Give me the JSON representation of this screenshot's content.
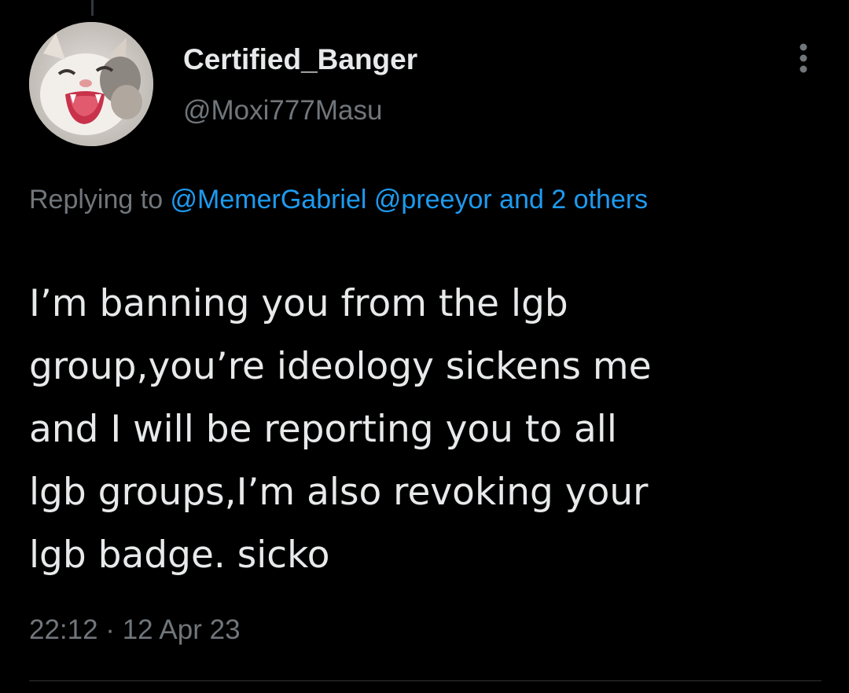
{
  "tweet": {
    "author": {
      "display_name": "Certified_Banger",
      "handle": "@Moxi777Masu",
      "avatar_icon": "kitten-avatar"
    },
    "more_icon": "more-vertical-icon",
    "reply_context": {
      "prefix": "Replying to ",
      "mentions": [
        "@MemerGabriel",
        "@preeyor"
      ],
      "others_link": "and 2 others"
    },
    "text": "I’m banning you from the lgb\ngroup,you’re ideology sickens me\nand I will be reporting you to all\nlgb groups,I’m also revoking your\nlgb badge. sicko",
    "timestamp": "22:12 · 12 Apr 23"
  },
  "colors": {
    "background": "#000000",
    "primary_text": "#e7e9ea",
    "secondary_text": "#71767b",
    "link": "#1d9bf0",
    "divider": "#2f3336"
  }
}
